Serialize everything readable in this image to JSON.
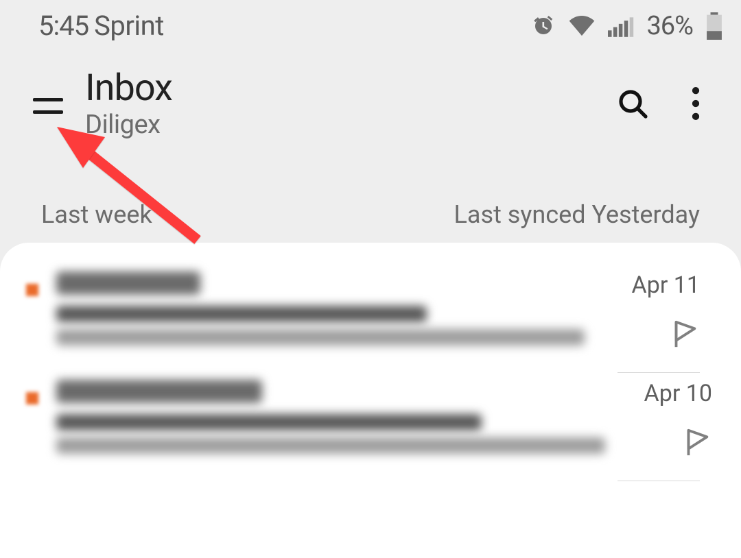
{
  "status": {
    "time": "5:45",
    "carrier": "Sprint",
    "battery_pct": "36%"
  },
  "header": {
    "title": "Inbox",
    "subtitle": "Diligex"
  },
  "section": {
    "label": "Last week",
    "sync_text": "Last synced Yesterday"
  },
  "messages": [
    {
      "date": "Apr 11"
    },
    {
      "date": "Apr 10"
    }
  ]
}
